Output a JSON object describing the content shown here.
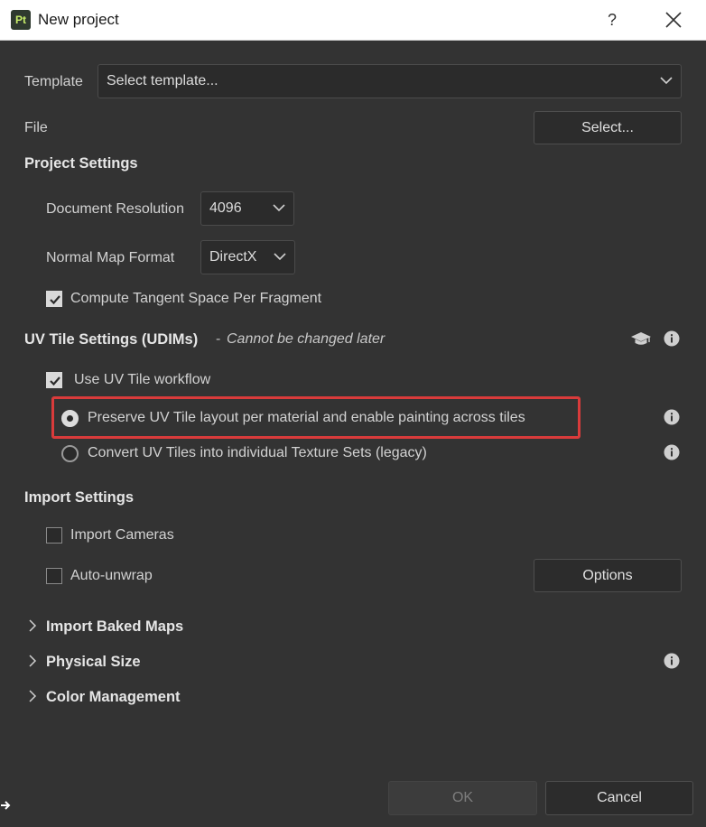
{
  "window": {
    "app_logo_text": "Pt",
    "title": "New project",
    "help_label": "?"
  },
  "template": {
    "label": "Template",
    "value": "Select template..."
  },
  "file": {
    "label": "File",
    "button": "Select..."
  },
  "project_settings": {
    "title": "Project Settings",
    "resolution_label": "Document Resolution",
    "resolution_value": "4096",
    "normal_map_label": "Normal Map Format",
    "normal_map_value": "DirectX",
    "tangent_label": "Compute Tangent Space Per Fragment",
    "tangent_checked": true
  },
  "uv_tile": {
    "title": "UV Tile Settings (UDIMs)",
    "separator": "-",
    "note": "Cannot be changed later",
    "workflow_label": "Use UV Tile workflow",
    "workflow_checked": true,
    "option_preserve": "Preserve UV Tile layout per material and enable painting across tiles",
    "option_convert": "Convert UV Tiles into individual Texture Sets (legacy)",
    "selected_option": "preserve"
  },
  "import_settings": {
    "title": "Import Settings",
    "cameras_label": "Import Cameras",
    "cameras_checked": false,
    "unwrap_label": "Auto-unwrap",
    "unwrap_checked": false,
    "options_button": "Options"
  },
  "expanders": {
    "baked_maps": "Import Baked Maps",
    "physical_size": "Physical Size",
    "color_management": "Color Management"
  },
  "footer": {
    "ok": "OK",
    "cancel": "Cancel"
  },
  "colors": {
    "background": "#333333",
    "highlight": "#d93b3b",
    "logo_accent": "#c9f06a"
  }
}
